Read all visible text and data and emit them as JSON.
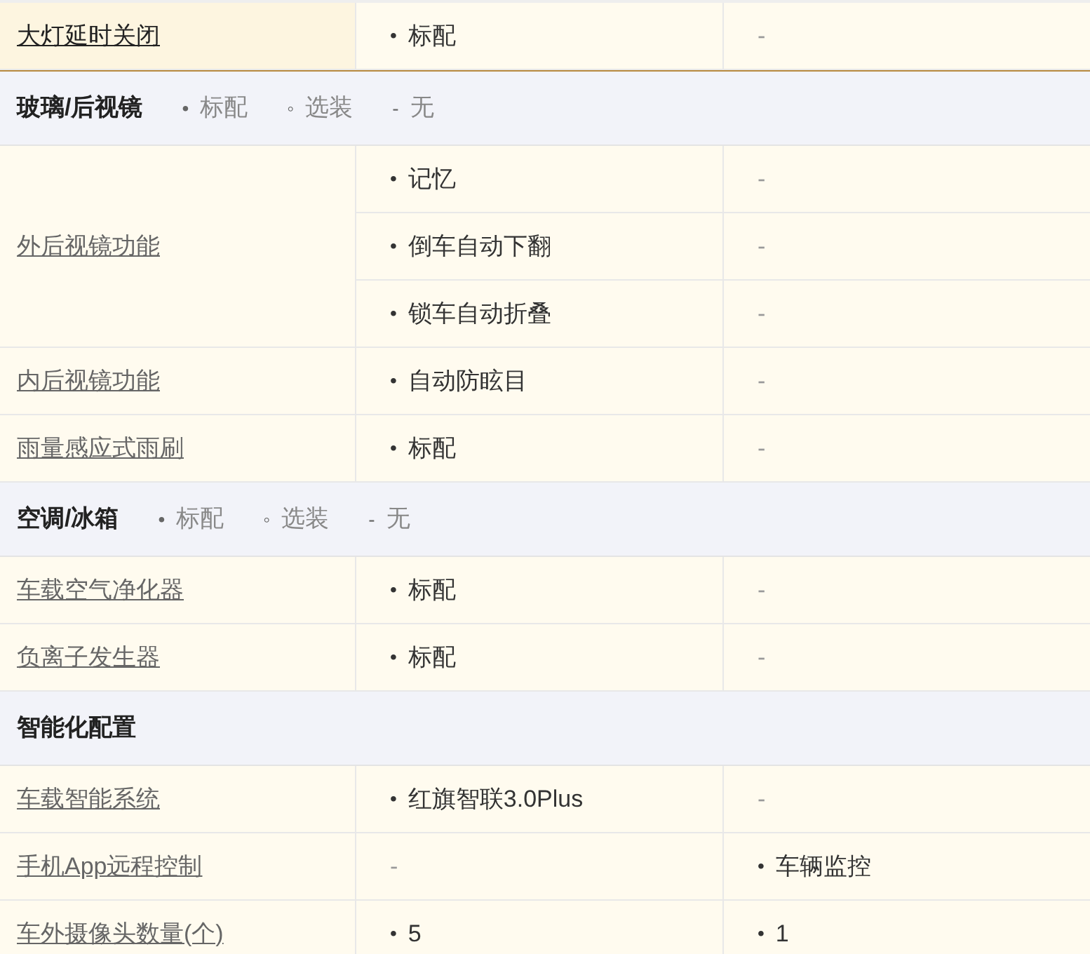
{
  "rows": [
    {
      "kind": "item",
      "label": "大灯延时关闭",
      "highlighted": true,
      "values": [
        [
          {
            "bullet": "•",
            "text": "标配"
          },
          {
            "text": "-"
          }
        ]
      ]
    },
    {
      "kind": "section",
      "title": "玻璃/后视镜",
      "legend": [
        {
          "bullet": "•",
          "text": "标配"
        },
        {
          "bullet": "◦",
          "text": "选装"
        },
        {
          "bullet": "-",
          "text": "无"
        }
      ]
    },
    {
      "kind": "item",
      "label": "外后视镜功能",
      "highlighted": false,
      "values": [
        [
          {
            "bullet": "•",
            "text": "记忆"
          },
          {
            "text": "-"
          }
        ],
        [
          {
            "bullet": "•",
            "text": "倒车自动下翻"
          },
          {
            "text": "-"
          }
        ],
        [
          {
            "bullet": "•",
            "text": "锁车自动折叠"
          },
          {
            "text": "-"
          }
        ]
      ]
    },
    {
      "kind": "item",
      "label": "内后视镜功能",
      "highlighted": false,
      "values": [
        [
          {
            "bullet": "•",
            "text": "自动防眩目"
          },
          {
            "text": "-"
          }
        ]
      ]
    },
    {
      "kind": "item",
      "label": "雨量感应式雨刷",
      "highlighted": false,
      "values": [
        [
          {
            "bullet": "•",
            "text": "标配"
          },
          {
            "text": "-"
          }
        ]
      ]
    },
    {
      "kind": "section",
      "title": "空调/冰箱",
      "legend": [
        {
          "bullet": "•",
          "text": "标配"
        },
        {
          "bullet": "◦",
          "text": "选装"
        },
        {
          "bullet": "-",
          "text": "无"
        }
      ]
    },
    {
      "kind": "item",
      "label": "车载空气净化器",
      "highlighted": false,
      "values": [
        [
          {
            "bullet": "•",
            "text": "标配"
          },
          {
            "text": "-"
          }
        ]
      ]
    },
    {
      "kind": "item",
      "label": "负离子发生器",
      "highlighted": false,
      "values": [
        [
          {
            "bullet": "•",
            "text": "标配"
          },
          {
            "text": "-"
          }
        ]
      ]
    },
    {
      "kind": "section",
      "title": "智能化配置"
    },
    {
      "kind": "item",
      "label": "车载智能系统",
      "highlighted": false,
      "values": [
        [
          {
            "bullet": "•",
            "text": "红旗智联3.0Plus"
          },
          {
            "text": "-"
          }
        ]
      ]
    },
    {
      "kind": "item",
      "label": "手机App远程控制",
      "highlighted": false,
      "values": [
        [
          {
            "text": "-"
          },
          {
            "bullet": "•",
            "text": "车辆监控"
          }
        ]
      ]
    },
    {
      "kind": "item",
      "label": "车外摄像头数量(个)",
      "highlighted": false,
      "values": [
        [
          {
            "bullet": "•",
            "text": "5"
          },
          {
            "bullet": "•",
            "text": "1"
          }
        ]
      ]
    }
  ]
}
